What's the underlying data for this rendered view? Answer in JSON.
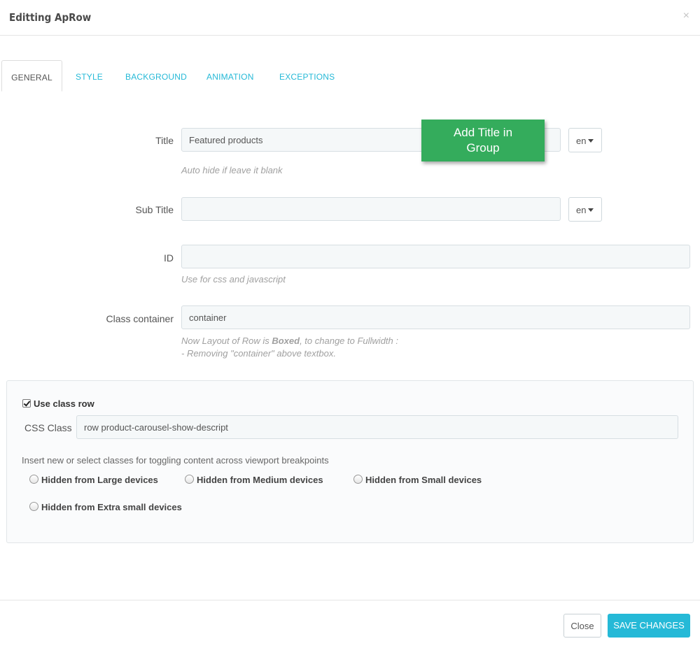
{
  "modal": {
    "title": "Editting ApRow",
    "close_glyph": "×"
  },
  "tabs": [
    {
      "label": "GENERAL",
      "active": true
    },
    {
      "label": "STYLE",
      "active": false
    },
    {
      "label": "BACKGROUND",
      "active": false
    },
    {
      "label": "ANIMATION",
      "active": false
    },
    {
      "label": "EXCEPTIONS",
      "active": false
    }
  ],
  "form": {
    "title": {
      "label": "Title",
      "value": "Featured products",
      "lang": "en",
      "help": "Auto hide if leave it blank"
    },
    "sub_title": {
      "label": "Sub Title",
      "value": "",
      "lang": "en"
    },
    "id": {
      "label": "ID",
      "value": "",
      "help": "Use for css and javascript"
    },
    "class_container": {
      "label": "Class container",
      "value": "container",
      "help_prefix": "Now Layout of Row is ",
      "help_bold": "Boxed",
      "help_suffix": ", to change to Fullwidth :",
      "help_line2": "- Removing \"container\" above textbox."
    }
  },
  "callout": {
    "line1": "Add Title  in",
    "line2": "Group"
  },
  "row_panel": {
    "use_class_row_label": "Use class row",
    "use_class_row_checked": true,
    "css_class_label": "CSS Class",
    "css_class_value": "row product-carousel-show-descript",
    "breakpoints_label": "Insert new or select classes for toggling content across viewport breakpoints",
    "options": [
      "Hidden from Large devices",
      "Hidden from Medium devices",
      "Hidden from Small devices",
      "Hidden from Extra small devices"
    ]
  },
  "footer": {
    "close_label": "Close",
    "save_label": "SAVE CHANGES"
  },
  "colors": {
    "accent": "#25b9d7",
    "callout": "#34ac5c"
  }
}
